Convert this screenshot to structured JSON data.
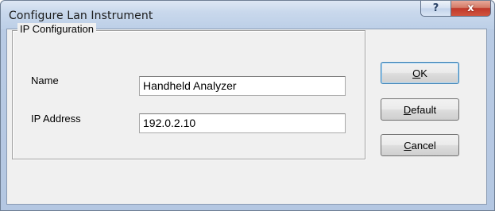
{
  "window": {
    "title": "Configure Lan Instrument",
    "help_glyph": "?",
    "close_glyph": "x"
  },
  "group": {
    "label": "IP Configuration",
    "fields": {
      "name": {
        "label": "Name",
        "value": "Handheld Analyzer"
      },
      "ip": {
        "label": "IP Address",
        "value": "192.0.2.10"
      }
    }
  },
  "buttons": {
    "ok": {
      "mnemonic": "O",
      "rest": "K"
    },
    "default": {
      "mnemonic": "D",
      "rest": "efault"
    },
    "cancel": {
      "mnemonic": "C",
      "rest": "ancel"
    }
  },
  "colors": {
    "titlebar": "#c9d8ec",
    "close_button": "#c0392b",
    "dialog_background": "#f0f0f0"
  }
}
